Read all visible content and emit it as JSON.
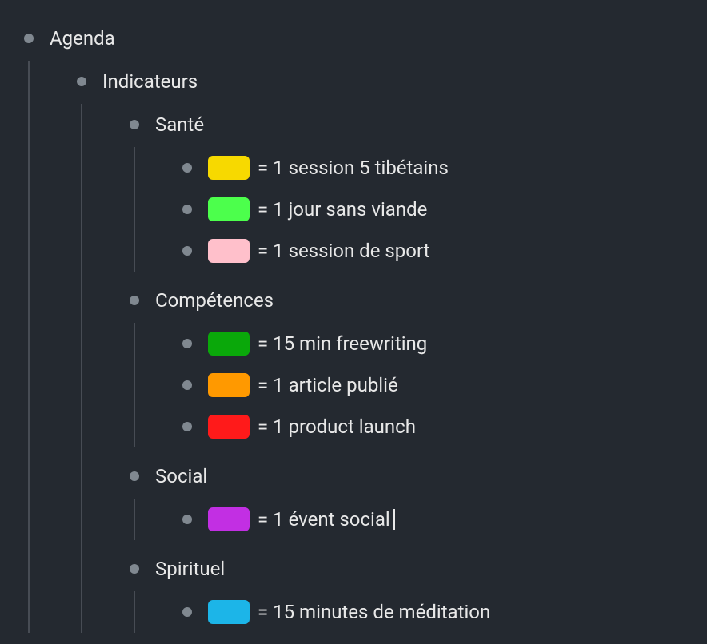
{
  "outline": {
    "title": "Agenda",
    "children": [
      {
        "title": "Indicateurs",
        "groups": [
          {
            "title": "Santé",
            "items": [
              {
                "color": "#f7d900",
                "text": "= 1 session 5 tibétains"
              },
              {
                "color": "#4cff4c",
                "text": "=  1 jour sans viande"
              },
              {
                "color": "#ffc0cb",
                "text": "= 1 session de sport"
              }
            ]
          },
          {
            "title": "Compétences",
            "items": [
              {
                "color": "#0aa80a",
                "text": "= 15 min freewriting"
              },
              {
                "color": "#ff9900",
                "text": "= 1 article publié"
              },
              {
                "color": "#ff1a1a",
                "text": "= 1 product launch"
              }
            ]
          },
          {
            "title": "Social",
            "items": [
              {
                "color": "#c22fe3",
                "text": "= 1 évent social",
                "cursor": true
              }
            ]
          },
          {
            "title": "Spirituel",
            "items": [
              {
                "color": "#1cb5e8",
                "text": "= 15 minutes de méditation"
              }
            ]
          }
        ]
      }
    ]
  }
}
